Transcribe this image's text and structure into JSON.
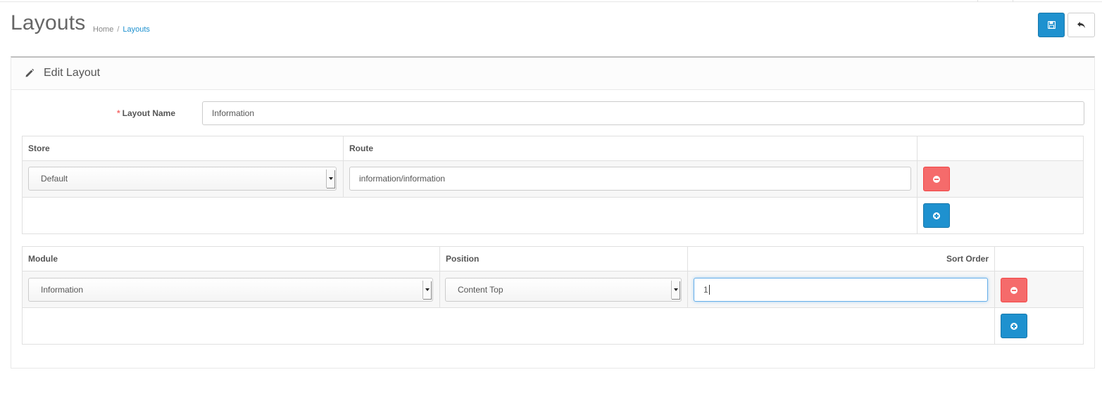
{
  "header": {
    "title": "Layouts",
    "breadcrumb": [
      {
        "label": "Home"
      },
      {
        "label": "Layouts"
      }
    ]
  },
  "panel": {
    "title": "Edit Layout",
    "layout_name_label": "Layout Name",
    "layout_name_value": "Information"
  },
  "routes_table": {
    "headers": {
      "store": "Store",
      "route": "Route"
    },
    "rows": [
      {
        "store": "Default",
        "route": "information/information"
      }
    ]
  },
  "modules_table": {
    "headers": {
      "module": "Module",
      "position": "Position",
      "sort_order": "Sort Order"
    },
    "rows": [
      {
        "module": "Information",
        "position": "Content Top",
        "sort_order": "1"
      }
    ]
  },
  "icons": {
    "save": "save-icon",
    "back": "reply-icon",
    "edit": "pencil-icon",
    "remove": "minus-circle-icon",
    "add": "plus-circle-icon"
  },
  "colors": {
    "primary": "#1e91cf",
    "danger": "#f56b6b",
    "link": "#1e91cf"
  }
}
